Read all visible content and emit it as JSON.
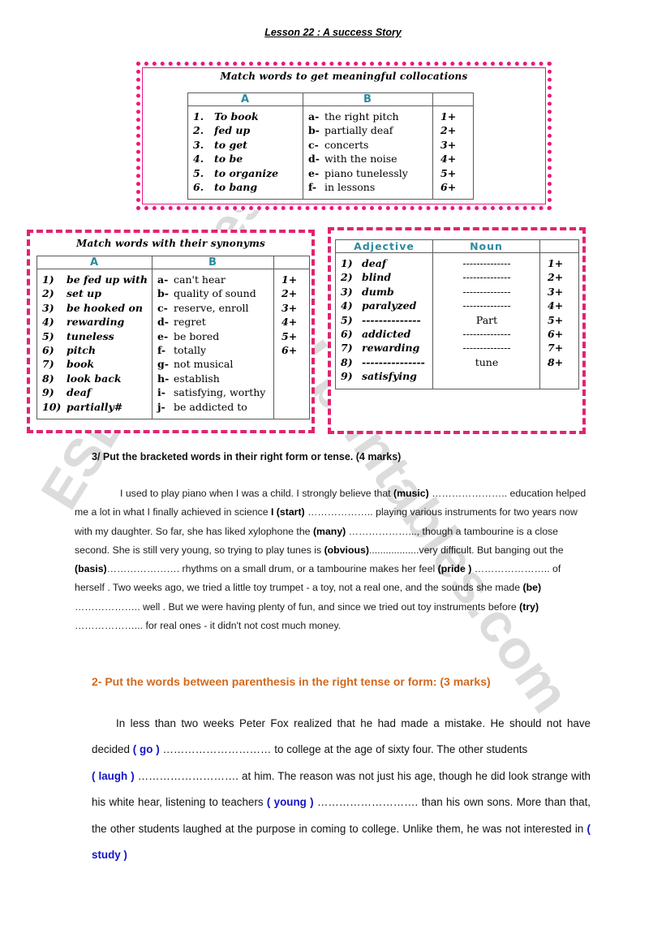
{
  "watermark": {
    "line1": "ESLprintables.com",
    "line2": "ESLprintables.com"
  },
  "header": {
    "lesson_title": "Lesson 22 :  A success Story"
  },
  "colors": {
    "beaded_border": "#e8197d",
    "dashed_border": "#e0246f",
    "table_header_text": "#2d8a9e",
    "section2_heading": "#d2691e",
    "bracket_word": "#1414c8"
  },
  "exercise1": {
    "caption": "Match words to get meaningful collocations",
    "columns": [
      "A",
      "B",
      ""
    ],
    "colA": [
      {
        "mark": "1.",
        "text": "To book"
      },
      {
        "mark": "2.",
        "text": "fed up"
      },
      {
        "mark": "3.",
        "text": "to get"
      },
      {
        "mark": "4.",
        "text": "to be"
      },
      {
        "mark": "5.",
        "text": "to organize"
      },
      {
        "mark": "6.",
        "text": "to bang"
      }
    ],
    "colB": [
      {
        "mark": "a-",
        "text": "the right pitch"
      },
      {
        "mark": "b-",
        "text": "partially deaf"
      },
      {
        "mark": "c-",
        "text": "concerts"
      },
      {
        "mark": "d-",
        "text": "with the noise"
      },
      {
        "mark": "e-",
        "text": "piano tunelessly"
      },
      {
        "mark": "f-",
        "text": "in lessons"
      }
    ],
    "colC": [
      "1+",
      "2+",
      "3+",
      "4+",
      "5+",
      "6+"
    ]
  },
  "exercise2": {
    "caption": "Match words with their synonyms",
    "columns": [
      "A",
      "B",
      ""
    ],
    "colA": [
      {
        "mark": "1)",
        "text": "be fed up with"
      },
      {
        "mark": "2)",
        "text": "set up"
      },
      {
        "mark": "3)",
        "text": "be hooked on"
      },
      {
        "mark": "4)",
        "text": "rewarding"
      },
      {
        "mark": "5)",
        "text": "tuneless"
      },
      {
        "mark": "6)",
        "text": "pitch"
      },
      {
        "mark": "7)",
        "text": "book"
      },
      {
        "mark": "8)",
        "text": "look back"
      },
      {
        "mark": "9)",
        "text": "deaf"
      },
      {
        "mark": "10)",
        "text": "partially#"
      }
    ],
    "colB": [
      {
        "mark": "a-",
        "text": "can't hear"
      },
      {
        "mark": "b-",
        "text": "quality of sound"
      },
      {
        "mark": "c-",
        "text": "reserve, enroll"
      },
      {
        "mark": "d-",
        "text": "regret"
      },
      {
        "mark": "e-",
        "text": "be bored"
      },
      {
        "mark": "f-",
        "text": "totally"
      },
      {
        "mark": "g-",
        "text": "not musical"
      },
      {
        "mark": "h-",
        "text": "establish"
      },
      {
        "mark": "i-",
        "text": "satisfying, worthy"
      },
      {
        "mark": "j-",
        "text": "be addicted to"
      }
    ],
    "colC": [
      "1+",
      "2+",
      "3+",
      "4+",
      "5+",
      "6+"
    ]
  },
  "exercise3": {
    "columns": [
      "Adjective",
      "Noun",
      ""
    ],
    "adjectives": [
      {
        "mark": "1)",
        "text": "deaf"
      },
      {
        "mark": "2)",
        "text": "blind"
      },
      {
        "mark": "3)",
        "text": "dumb"
      },
      {
        "mark": "4)",
        "text": "paralyzed"
      },
      {
        "mark": "5)",
        "text": "--------------"
      },
      {
        "mark": "6)",
        "text": "addicted"
      },
      {
        "mark": "7)",
        "text": "rewarding"
      },
      {
        "mark": "8)",
        "text": "---------------"
      },
      {
        "mark": "9)",
        "text": "satisfying"
      }
    ],
    "nouns": [
      "--------------",
      "--------------",
      "--------------",
      "--------------",
      "Part",
      "--------------",
      "--------------",
      "tune",
      ""
    ],
    "colC": [
      "1+",
      "2+",
      "3+",
      "4+",
      "5+",
      "6+",
      "7+",
      "8+"
    ]
  },
  "section3": {
    "heading": "3/ Put the bracketed words in their right form or tense. (4 marks)",
    "text_parts": [
      "I used to play piano when I was a child. I strongly believe that ",
      "(music)",
      " ………………….. education helped me a lot in what I finally achieved in science ",
      "I (start)",
      " ……………….. playing various instruments for two years now with my daughter. So far, she has liked xylophone the ",
      "(many)",
      " ………………..., though a tambourine is a close second. She is still very young, so trying to play tunes is ",
      "(obvious)",
      "..................very   difficult. But banging out the ",
      "(basis)",
      "…………………. rhythms on a small drum, or a tambourine makes her feel ",
      "(pride )",
      " ………………….. of herself . Two weeks ago, we tried a little toy trumpet - a toy, not a real one, and the sounds she made ",
      "(be)",
      " ……………….. well  . But we were having plenty of fun, and since we tried  out toy instruments before ",
      "(try)",
      " ………………... for real ones - it didn't  not cost much money."
    ]
  },
  "section2": {
    "heading": "2- Put the words between parenthesis in the right tense or form: (3 marks)",
    "text_parts": [
      "In less than two weeks Peter Fox realized that he had made a mistake. He should not have decided ",
      "( go )",
      " ………………………… to college at the age of sixty four. The other students ",
      "( laugh )",
      " ………………………. at him. The reason was not just his age, though he did look strange with his white hear, listening to teachers ",
      "( young )",
      " ………………………. than his own sons. More than that, the other students laughed at the purpose in coming to college. Unlike them, he was not interested in ",
      "( study )"
    ]
  }
}
